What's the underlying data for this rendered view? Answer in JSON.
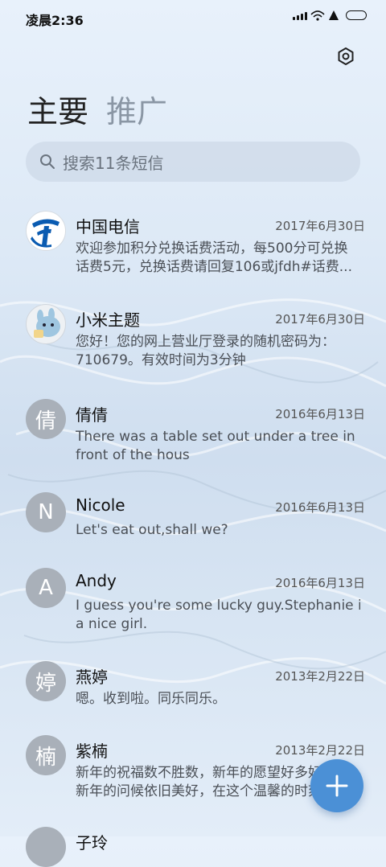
{
  "status_bar": {
    "time": "凌晨2:36"
  },
  "tabs": [
    {
      "label": "主要",
      "active": true
    },
    {
      "label": "推广",
      "active": false
    }
  ],
  "search": {
    "placeholder": "搜索11条短信"
  },
  "messages": [
    {
      "name": "中国电信",
      "date": "2017年6月30日",
      "line1": "欢迎参加积分兑换话费活动，每500分可兑换",
      "line2": "话费5元，兑换话费请回复106或jfdh#话费...",
      "avatar": "china-telecom-logo"
    },
    {
      "name": "小米主题",
      "date": "2017年6月30日",
      "line1": "您好！您的网上营业厅登录的随机密码为：",
      "line2": "710679。有效时间为3分钟",
      "avatar": "mi-theme-bunny"
    },
    {
      "name": "倩倩",
      "date": "2016年6月13日",
      "line1": "There was a table set out under a tree in",
      "line2": "front of the hous",
      "avatar_letter": "倩"
    },
    {
      "name": "Nicole",
      "date": "2016年6月13日",
      "line1": "Let's eat out,shall we?",
      "line2": "",
      "avatar_letter": "N"
    },
    {
      "name": "Andy",
      "date": "2016年6月13日",
      "line1": "I guess you're some lucky guy.Stephanie is",
      "line2": "a nice girl.",
      "avatar_letter": "A"
    },
    {
      "name": "燕婷",
      "date": "2013年2月22日",
      "line1": "嗯。收到啦。同乐同乐。",
      "line2": "",
      "avatar_letter": "婷"
    },
    {
      "name": "紫楠",
      "date": "2013年2月22日",
      "line1": "新年的祝福数不胜数，新年的愿望好多好多",
      "line2": "新年的问候依旧美好，在这个温馨的时刻",
      "avatar_letter": "楠"
    },
    {
      "name": "子玲",
      "date": "",
      "line1": "",
      "line2": "",
      "avatar_letter": ""
    }
  ],
  "icons": {
    "settings": "settings-icon",
    "search": "search-icon",
    "compose": "plus-icon"
  },
  "colors": {
    "accent": "#4b90d6",
    "avatar_bg": "#a9b0b9"
  }
}
